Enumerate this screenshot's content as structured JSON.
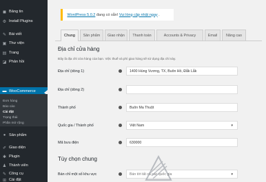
{
  "sidebar": {
    "items": [
      {
        "label": "Bảng tin",
        "icon": "dashboard-icon",
        "glyph": "◼"
      },
      {
        "label": "Install Plugins",
        "icon": "gear-icon",
        "glyph": "⚙"
      },
      {
        "label": "Bài viết",
        "icon": "pin-icon",
        "glyph": "✎"
      },
      {
        "label": "Thư viện",
        "icon": "media-icon",
        "glyph": "▣"
      },
      {
        "label": "Trang",
        "icon": "page-icon",
        "glyph": "▤"
      },
      {
        "label": "Phản hồi",
        "icon": "comment-icon",
        "glyph": "◪"
      },
      {
        "label": "WooCommerce",
        "icon": "woocommerce-icon",
        "glyph": "▬",
        "active": true
      }
    ],
    "submenu": [
      {
        "label": "Đơn hàng"
      },
      {
        "label": "Báo cáo"
      },
      {
        "label": "Cài đặt",
        "current": true
      },
      {
        "label": "Trạng thái"
      },
      {
        "label": "Phần mở rộng"
      }
    ],
    "items_after": [
      {
        "label": "Sản phẩm",
        "icon": "product-icon",
        "glyph": "●"
      },
      {
        "label": "Giao diện",
        "icon": "appearance-icon",
        "glyph": "✐"
      },
      {
        "label": "Plugin",
        "icon": "plugin-icon",
        "glyph": "✱"
      },
      {
        "label": "Thành viên",
        "icon": "users-icon",
        "glyph": "♟"
      },
      {
        "label": "Công cụ",
        "icon": "tools-icon",
        "glyph": "✎"
      },
      {
        "label": "Cài đặt",
        "icon": "settings-icon",
        "glyph": "⊞"
      }
    ]
  },
  "notice": {
    "link1": "WordPress 5.0.2",
    "middle": "đang có sẵn!",
    "link2": "Vui lòng cập nhật ngay",
    "end": "."
  },
  "tabs": [
    "Chung",
    "Sản phẩm",
    "Giao nhận",
    "Thanh toán",
    "Accounts & Privacy",
    "Email",
    "Nâng cao"
  ],
  "active_tab": "Chung",
  "section": {
    "title": "Địa chỉ cửa hàng",
    "description": "Đây là địa chỉ cửa hàng của bạn. Việc thuế và phí giao hàng sẽ sử dụng địa chỉ này."
  },
  "fields": [
    {
      "label": "Địa chỉ (dòng 1)",
      "value": "1400 Hùng Vương, TX, Buôn Hồ, Đắk Lắk",
      "type": "text"
    },
    {
      "label": "Địa chỉ (dòng 2)",
      "value": "",
      "type": "text"
    },
    {
      "label": "Thành phố",
      "value": "Buôn Ma Thuột",
      "type": "text"
    },
    {
      "label": "Quốc gia / Thành phố",
      "value": "Việt Nam",
      "type": "select"
    },
    {
      "label": "Mã bưu điện",
      "value": "630000",
      "type": "text"
    }
  ],
  "section2": {
    "title": "Tùy chọn chung"
  },
  "field_sell": {
    "label": "Bán chỉ một số khu vực",
    "value": "Bán tới tất cả các quốc gia"
  }
}
